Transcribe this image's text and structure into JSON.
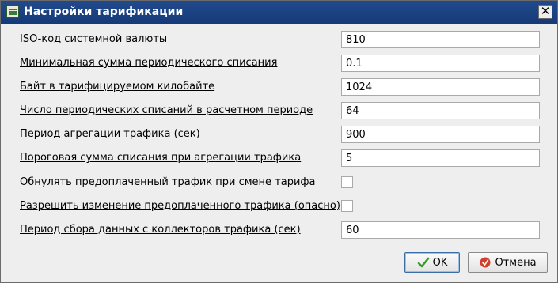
{
  "window": {
    "title": "Настройки тарификации",
    "close_glyph": "✕"
  },
  "settings": [
    {
      "label": "ISO-код системной валюты",
      "type": "text",
      "value": "810"
    },
    {
      "label": "Минимальная сумма периодического списания",
      "type": "text",
      "value": "0.1"
    },
    {
      "label": "Байт в тарифицируемом килобайте",
      "type": "text",
      "value": "1024"
    },
    {
      "label": "Число периодических списаний в расчетном периоде",
      "type": "text",
      "value": "64"
    },
    {
      "label": "Период агрегации трафика (сек)",
      "type": "text",
      "value": "900"
    },
    {
      "label": "Пороговая сумма списания при агрегации трафика",
      "type": "text",
      "value": "5"
    },
    {
      "label": "Обнулять предоплаченный трафик при смене тарифа",
      "type": "checkbox",
      "checked": false
    },
    {
      "label": "Разрешить изменение предоплаченного трафика (опасно)",
      "type": "checkbox",
      "checked": false
    },
    {
      "label": "Период сбора данных с коллекторов трафика (сек)",
      "type": "text",
      "value": "60"
    }
  ],
  "buttons": {
    "ok_label": "OK",
    "cancel_label": "Отмена"
  },
  "colors": {
    "titlebar": "#1a4280",
    "ok_icon": "#3a9a2a",
    "cancel_icon": "#d0402a"
  },
  "icons": {
    "app": "settings-table-icon",
    "ok": "checkmark-icon",
    "cancel": "cancel-icon",
    "close": "close-icon"
  }
}
